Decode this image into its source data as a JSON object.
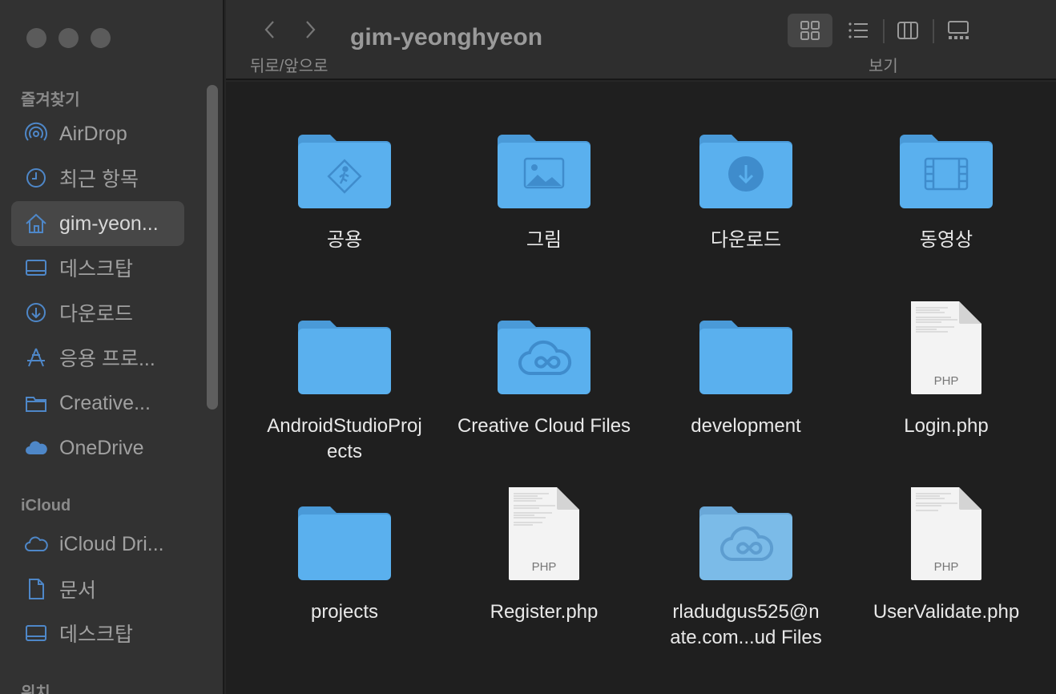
{
  "window": {
    "title": "gim-yeonghyeon"
  },
  "toolbar": {
    "back_label": "뒤로/앞으로",
    "view_label": "보기"
  },
  "sidebar": {
    "favorites_title": "즐겨찾기",
    "favorites": [
      {
        "label": "AirDrop",
        "icon": "airdrop-icon"
      },
      {
        "label": "최근 항목",
        "icon": "clock-icon"
      },
      {
        "label": "gim-yeon...",
        "icon": "home-icon"
      },
      {
        "label": "데스크탑",
        "icon": "desktop-icon"
      },
      {
        "label": "다운로드",
        "icon": "download-icon"
      },
      {
        "label": "응용 프로...",
        "icon": "applications-icon"
      },
      {
        "label": "Creative...",
        "icon": "folder-icon"
      },
      {
        "label": "OneDrive",
        "icon": "cloud-icon"
      }
    ],
    "icloud_title": "iCloud",
    "icloud": [
      {
        "label": "iCloud Dri...",
        "icon": "icloud-icon"
      },
      {
        "label": "문서",
        "icon": "document-icon"
      },
      {
        "label": "데스크탑",
        "icon": "desktop-icon"
      }
    ],
    "locations_title": "위치"
  },
  "files": [
    {
      "name": "공용",
      "type": "folder",
      "badge": "public"
    },
    {
      "name": "그림",
      "type": "folder",
      "badge": "pictures"
    },
    {
      "name": "다운로드",
      "type": "folder",
      "badge": "download"
    },
    {
      "name": "동영상",
      "type": "folder",
      "badge": "movies"
    },
    {
      "name": "AndroidStudioProj ects",
      "type": "folder",
      "badge": ""
    },
    {
      "name": "Creative Cloud Files",
      "type": "folder",
      "badge": "creative-cloud"
    },
    {
      "name": "development",
      "type": "folder",
      "badge": ""
    },
    {
      "name": "Login.php",
      "type": "php",
      "badge": "PHP"
    },
    {
      "name": "projects",
      "type": "folder",
      "badge": ""
    },
    {
      "name": "Register.php",
      "type": "php",
      "badge": "PHP"
    },
    {
      "name": "rladudgus525@n ate.com...ud Files",
      "type": "folder",
      "badge": "creative-cloud"
    },
    {
      "name": "UserValidate.php",
      "type": "php",
      "badge": "PHP"
    }
  ],
  "colors": {
    "folder": "#5ab0ee",
    "folder_dark": "#4a9ad8",
    "sidebar_icon": "#4e87c8"
  }
}
